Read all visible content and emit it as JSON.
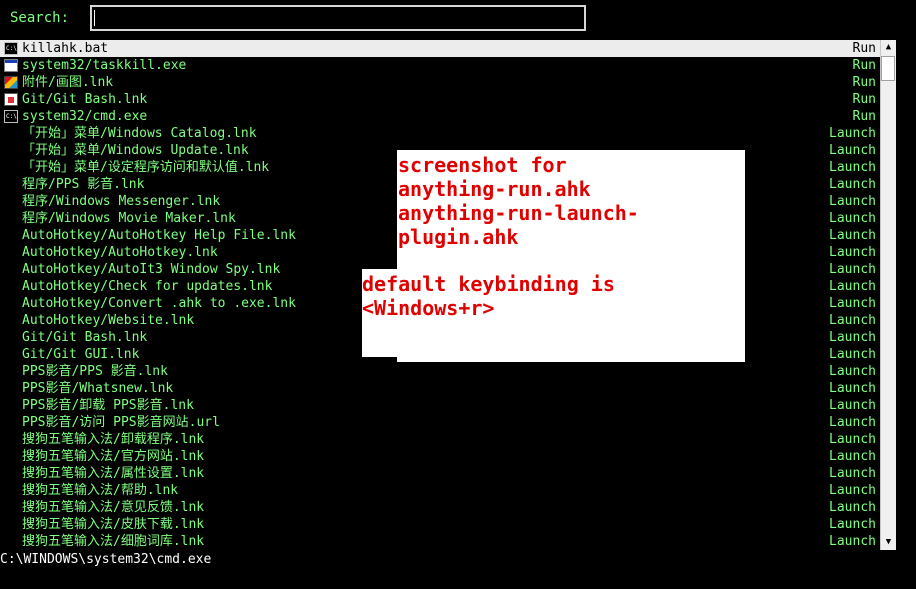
{
  "search": {
    "label": "Search:",
    "value": ""
  },
  "items": [
    {
      "name": "killahk.bat",
      "action": "Run",
      "icon": "cmd-icon",
      "selected": true
    },
    {
      "name": "system32/taskkill.exe",
      "action": "Run",
      "icon": "window-icon"
    },
    {
      "name": "附件/画图.lnk",
      "action": "Run",
      "icon": "paint-icon"
    },
    {
      "name": "Git/Git Bash.lnk",
      "action": "Run",
      "icon": "git-icon"
    },
    {
      "name": "system32/cmd.exe",
      "action": "Run",
      "icon": "cmd-icon"
    },
    {
      "name": "「开始」菜单/Windows Catalog.lnk",
      "action": "Launch"
    },
    {
      "name": "「开始」菜单/Windows Update.lnk",
      "action": "Launch"
    },
    {
      "name": "「开始」菜单/设定程序访问和默认值.lnk",
      "action": "Launch"
    },
    {
      "name": "程序/PPS 影音.lnk",
      "action": "Launch"
    },
    {
      "name": "程序/Windows Messenger.lnk",
      "action": "Launch"
    },
    {
      "name": "程序/Windows Movie Maker.lnk",
      "action": "Launch"
    },
    {
      "name": "AutoHotkey/AutoHotkey Help File.lnk",
      "action": "Launch"
    },
    {
      "name": "AutoHotkey/AutoHotkey.lnk",
      "action": "Launch"
    },
    {
      "name": "AutoHotkey/AutoIt3 Window Spy.lnk",
      "action": "Launch"
    },
    {
      "name": "AutoHotkey/Check for updates.lnk",
      "action": "Launch"
    },
    {
      "name": "AutoHotkey/Convert .ahk to .exe.lnk",
      "action": "Launch"
    },
    {
      "name": "AutoHotkey/Website.lnk",
      "action": "Launch"
    },
    {
      "name": "Git/Git Bash.lnk",
      "action": "Launch"
    },
    {
      "name": "Git/Git GUI.lnk",
      "action": "Launch"
    },
    {
      "name": "PPS影音/PPS 影音.lnk",
      "action": "Launch"
    },
    {
      "name": "PPS影音/Whatsnew.lnk",
      "action": "Launch"
    },
    {
      "name": "PPS影音/卸载 PPS影音.lnk",
      "action": "Launch"
    },
    {
      "name": "PPS影音/访问 PPS影音网站.url",
      "action": "Launch"
    },
    {
      "name": "搜狗五笔输入法/卸载程序.lnk",
      "action": "Launch"
    },
    {
      "name": "搜狗五笔输入法/官方网站.lnk",
      "action": "Launch"
    },
    {
      "name": "搜狗五笔输入法/属性设置.lnk",
      "action": "Launch"
    },
    {
      "name": "搜狗五笔输入法/帮助.lnk",
      "action": "Launch"
    },
    {
      "name": "搜狗五笔输入法/意见反馈.lnk",
      "action": "Launch"
    },
    {
      "name": "搜狗五笔输入法/皮肤下载.lnk",
      "action": "Launch"
    },
    {
      "name": "搜狗五笔输入法/细胞词库.lnk",
      "action": "Launch"
    }
  ],
  "status": {
    "text": "C:\\WINDOWS\\system32\\cmd.exe"
  },
  "overlay": {
    "line1": "screenshot for",
    "line2": "anything-run.ahk",
    "line3": "anything-run-launch-",
    "line4": "plugin.ahk",
    "line5": "default keybinding is",
    "line6": "<Windows+r>"
  },
  "colors": {
    "item_text": "#7fff7f",
    "selected_bg": "#ececec",
    "overlay_text": "#e00000"
  }
}
